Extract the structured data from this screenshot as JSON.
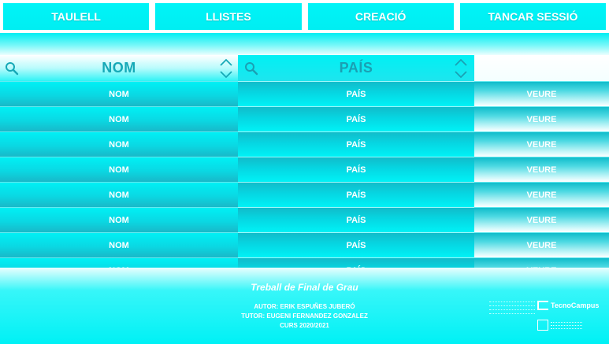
{
  "nav": {
    "items": [
      {
        "label": "TAULELL"
      },
      {
        "label": "LLISTES"
      },
      {
        "label": "CREACIÓ"
      },
      {
        "label": "TANCAR SESSIÓ"
      }
    ]
  },
  "table": {
    "headers": {
      "name": "NOM",
      "country": "PAÍS"
    },
    "rows": [
      {
        "name": "NOM",
        "country": "PAÍS",
        "action": "VEURE"
      },
      {
        "name": "NOM",
        "country": "PAÍS",
        "action": "VEURE"
      },
      {
        "name": "NOM",
        "country": "PAÍS",
        "action": "VEURE"
      },
      {
        "name": "NOM",
        "country": "PAÍS",
        "action": "VEURE"
      },
      {
        "name": "NOM",
        "country": "PAÍS",
        "action": "VEURE"
      },
      {
        "name": "NOM",
        "country": "PAÍS",
        "action": "VEURE"
      },
      {
        "name": "NOM",
        "country": "PAÍS",
        "action": "VEURE"
      },
      {
        "name": "NOM",
        "country": "PAÍS",
        "action": "VEURE"
      }
    ]
  },
  "footer": {
    "title": "Treball de Final de Grau",
    "author": "AUTOR: ERIK ESPUÑES JUBERÓ",
    "tutor": "TUTOR: EUGENI FERNANDEZ GONZALEZ",
    "course": "CURS 2020/2021",
    "logo_text": "TecnoCampus"
  },
  "colors": {
    "accent": "#00f1f5",
    "header_text": "#16a9b7"
  }
}
